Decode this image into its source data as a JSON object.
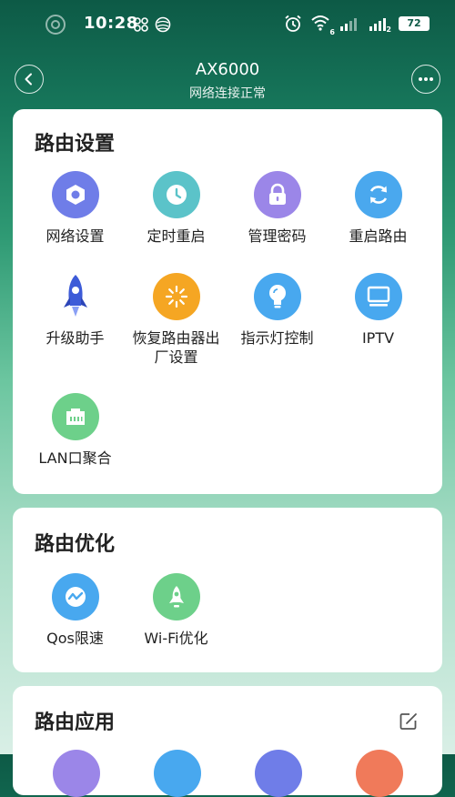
{
  "status_bar": {
    "time": "10:28",
    "battery": "72",
    "wifi_badge": "6",
    "sim2_badge": "2"
  },
  "header": {
    "title": "AX6000",
    "subtitle": "网络连接正常"
  },
  "sections": {
    "settings": {
      "title": "路由设置",
      "items": [
        {
          "label": "网络设置",
          "icon": "hexagon-settings-icon",
          "color": "#6f7de8"
        },
        {
          "label": "定时重启",
          "icon": "clock-icon",
          "color": "#5bc3c9"
        },
        {
          "label": "管理密码",
          "icon": "lock-icon",
          "color": "#9b86e8"
        },
        {
          "label": "重启路由",
          "icon": "refresh-icon",
          "color": "#4aa8ee"
        },
        {
          "label": "升级助手",
          "icon": "rocket-icon",
          "color": "#3d5bd8"
        },
        {
          "label": "恢复路由器出厂设置",
          "icon": "spinner-icon",
          "color": "#f5a623"
        },
        {
          "label": "指示灯控制",
          "icon": "bulb-icon",
          "color": "#48a8ef"
        },
        {
          "label": "IPTV",
          "icon": "monitor-icon",
          "color": "#48a8ef"
        },
        {
          "label": "LAN口聚合",
          "icon": "ethernet-port-icon",
          "color": "#6dd08a"
        }
      ]
    },
    "optimize": {
      "title": "路由优化",
      "items": [
        {
          "label": "Qos限速",
          "icon": "speed-wave-icon",
          "color": "#48a8ef"
        },
        {
          "label": "Wi-Fi优化",
          "icon": "rocket-outline-icon",
          "color": "#6dd08a"
        }
      ]
    },
    "apps": {
      "title": "路由应用",
      "edit_icon": "edit-icon"
    }
  }
}
